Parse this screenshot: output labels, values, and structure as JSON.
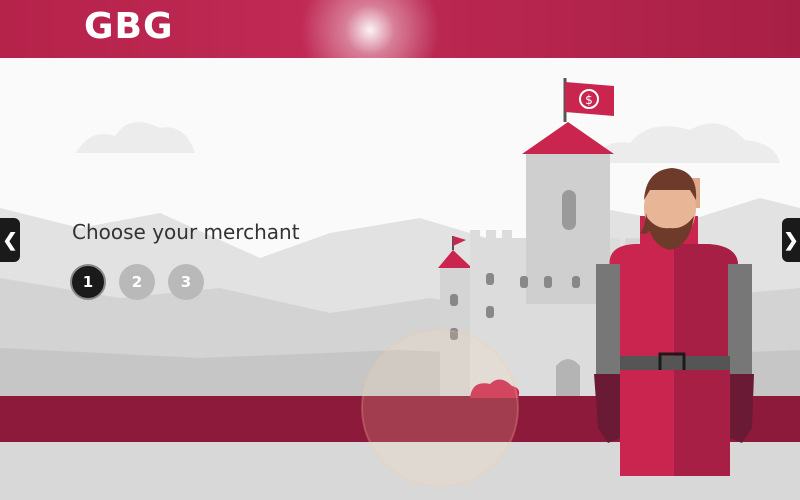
{
  "brand": {
    "logo": "GBG"
  },
  "main": {
    "prompt": "Choose your merchant",
    "steps": [
      {
        "label": "1",
        "active": true
      },
      {
        "label": "2",
        "active": false
      },
      {
        "label": "3",
        "active": false
      }
    ]
  },
  "navigation": {
    "prev_icon": "chevron-left-icon",
    "next_icon": "chevron-right-icon"
  },
  "colors": {
    "brand": "#b5224a",
    "dark_crimson": "#8e1a3b",
    "active_step": "#1a1a1a",
    "inactive_step": "#b9b9b9"
  },
  "flag": {
    "symbol": "$"
  }
}
